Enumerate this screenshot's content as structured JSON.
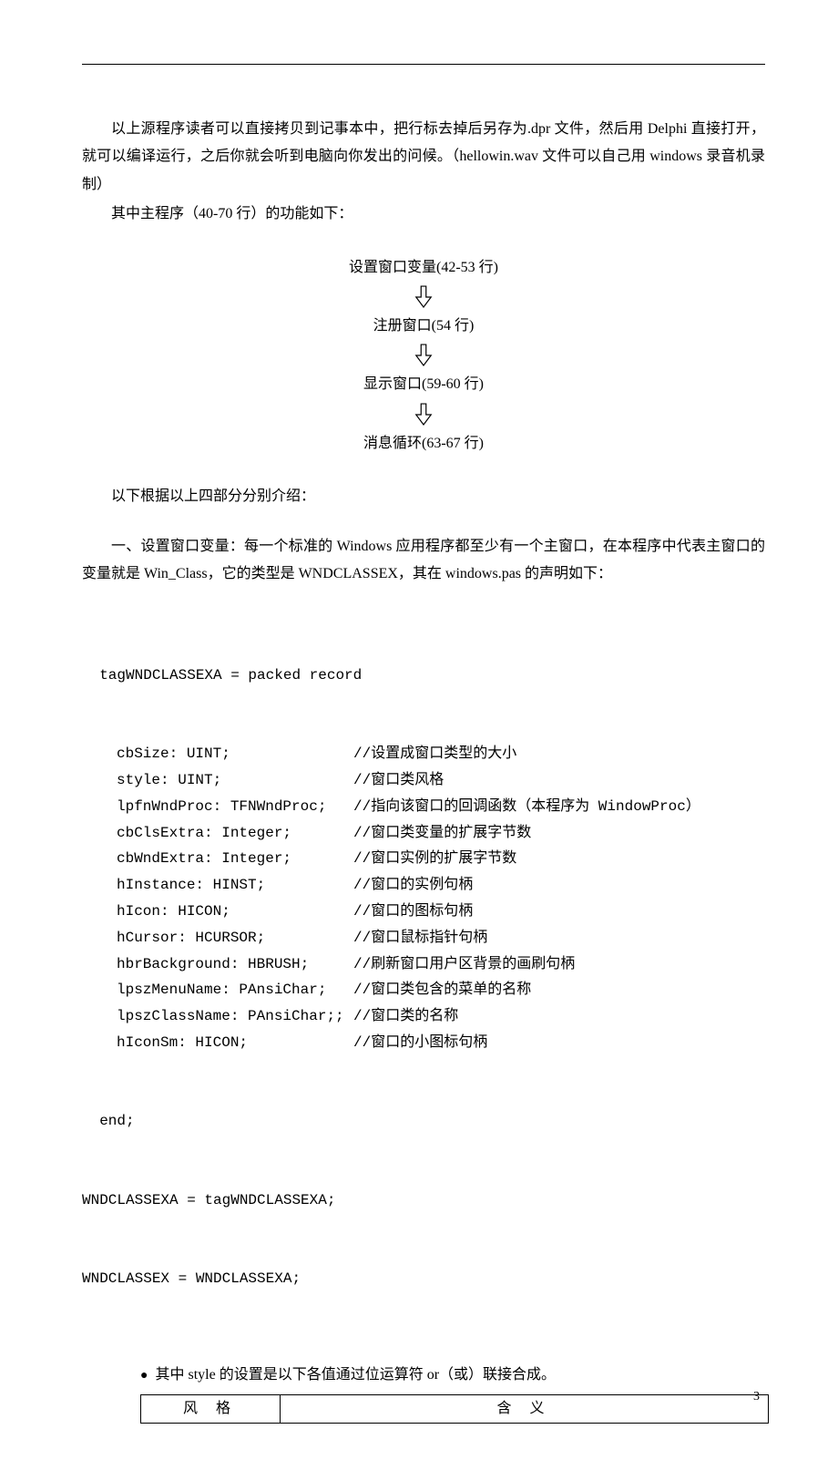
{
  "para1": "以上源程序读者可以直接拷贝到记事本中，把行标去掉后另存为.dpr 文件，然后用 Delphi 直接打开，就可以编译运行，之后你就会听到电脑向你发出的问候。（hellowin.wav 文件可以自己用 windows 录音机录制）",
  "para2": "其中主程序（40-70 行）的功能如下：",
  "flow": {
    "step1": "设置窗口变量(42-53 行)",
    "step2": "注册窗口(54 行)",
    "step3": "显示窗口(59-60 行)",
    "step4": "消息循环(63-67 行)"
  },
  "section_intro": "以下根据以上四部分分别介绍：",
  "section_one": "一、设置窗口变量：每一个标准的 Windows 应用程序都至少有一个主窗口，在本程序中代表主窗口的变量就是 Win_Class，它的类型是 WNDCLASSEX，其在 windows.pas 的声明如下：",
  "code": {
    "head": "  tagWNDCLASSEXA = packed record",
    "rows": [
      {
        "l": "cbSize: UINT;",
        "r": "//设置成窗口类型的大小"
      },
      {
        "l": "style: UINT;",
        "r": "//窗口类风格"
      },
      {
        "l": "lpfnWndProc: TFNWndProc;",
        "r": "//指向该窗口的回调函数（本程序为 WindowProc）"
      },
      {
        "l": "cbClsExtra: Integer;",
        "r": "//窗口类变量的扩展字节数"
      },
      {
        "l": "cbWndExtra: Integer;",
        "r": "//窗口实例的扩展字节数"
      },
      {
        "l": "hInstance: HINST;",
        "r": "//窗口的实例句柄"
      },
      {
        "l": "hIcon: HICON;",
        "r": "//窗口的图标句柄"
      },
      {
        "l": "hCursor: HCURSOR;",
        "r": "//窗口鼠标指针句柄"
      },
      {
        "l": "hbrBackground: HBRUSH;",
        "r": "//刷新窗口用户区背景的画刷句柄"
      },
      {
        "l": "lpszMenuName: PAnsiChar;",
        "r": "//窗口类包含的菜单的名称"
      },
      {
        "l": "lpszClassName: PAnsiChar;;",
        "r": "//窗口类的名称"
      },
      {
        "l": "hIconSm: HICON;",
        "r": "//窗口的小图标句柄"
      }
    ],
    "end1": "  end;",
    "end2": "WNDCLASSEXA = tagWNDCLASSEXA;",
    "end3": "WNDCLASSEX = WNDCLASSEXA;"
  },
  "bullet": "其中 style 的设置是以下各值通过位运算符 or（或）联接合成。",
  "table": {
    "h1": "风 格",
    "h2": "含  义"
  },
  "page_number": "3"
}
